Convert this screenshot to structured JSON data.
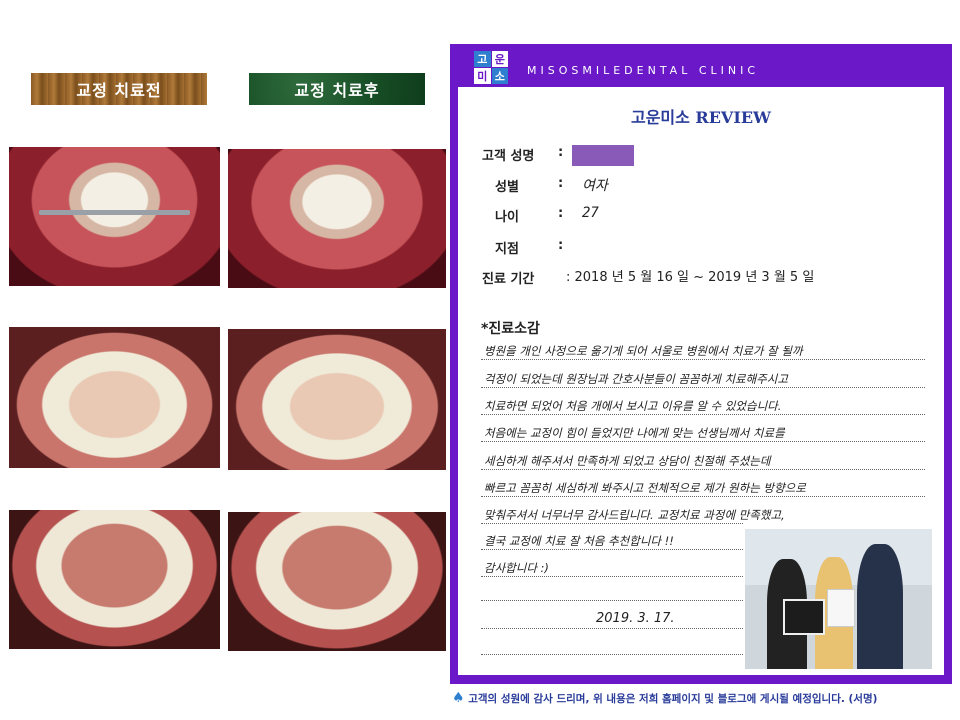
{
  "labels": {
    "before": "교정 치료전",
    "after": "교정 치료후"
  },
  "form": {
    "logo": [
      "고",
      "운",
      "미",
      "소"
    ],
    "clinic_name": "MISOSMILEDENTAL CLINIC",
    "title": "고운미소 REVIEW",
    "fields": [
      {
        "label": "고객 성명",
        "value": ""
      },
      {
        "label": "성별",
        "value": "여자"
      },
      {
        "label": "나이",
        "value": "27"
      },
      {
        "label": "지점",
        "value": ""
      },
      {
        "label": "진료 기간",
        "value": ": 2018 년  5 월  16 일   ~ 2019 년  3 월  5 일"
      }
    ],
    "colon": ":",
    "section_title": "*진료소감",
    "notes": [
      "병원을 개인 사정으로 옮기게 되어 서울로 병원에서 치료가 잘 될까",
      "걱정이 되었는데 원장님과 간호사분들이 꼼꼼하게 치료해주시고",
      "치료하면 되었어 처음 개에서 보시고 이유를 알 수 있었습니다.",
      "처음에는 교정이 힘이 들었지만 나에게 맞는 선생님께서 치료를",
      "세심하게 해주셔서 만족하게 되었고 상담이 친절해 주셨는데",
      "빠르고 꼼꼼히 세심하게 봐주시고 전체적으로 제가 원하는 방향으로",
      "맞춰주셔서 너무너무 감사드립니다. 교정치료 과정에 만족했고,",
      "결국 교정에 치료 잘 처음 추천합니다 !!",
      "감사합니다 :)"
    ],
    "date": "2019. 3. 17."
  },
  "footer": "고객의 성원에 감사 드리며, 위 내용은 저희 홈페이지 및 블로그에 게시될 예정입니다. (서명)"
}
